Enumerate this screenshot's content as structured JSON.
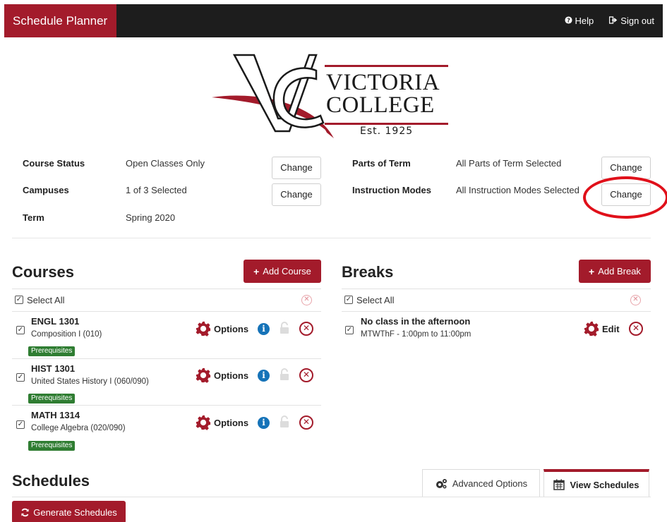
{
  "topbar": {
    "brand": "Schedule Planner",
    "help_label": "Help",
    "signout_label": "Sign out"
  },
  "logo": {
    "line1": "VICTORIA",
    "line2": "COLLEGE",
    "est": "Est. 1925"
  },
  "filters": {
    "course_status": {
      "label": "Course Status",
      "value": "Open Classes Only",
      "button": "Change"
    },
    "campuses": {
      "label": "Campuses",
      "value": "1 of 3 Selected",
      "button": "Change"
    },
    "term": {
      "label": "Term",
      "value": "Spring 2020"
    },
    "parts_of_term": {
      "label": "Parts of Term",
      "value": "All Parts of Term Selected",
      "button": "Change"
    },
    "instruction_modes": {
      "label": "Instruction Modes",
      "value": "All Instruction Modes Selected",
      "button": "Change"
    }
  },
  "courses": {
    "title": "Courses",
    "add_label": "Add Course",
    "select_all": "Select All",
    "items": [
      {
        "code": "ENGL 1301",
        "name": "Composition I (010)",
        "badge": "Prerequisites",
        "options": "Options"
      },
      {
        "code": "HIST 1301",
        "name": "United States History I (060/090)",
        "badge": "Prerequisites",
        "options": "Options"
      },
      {
        "code": "MATH 1314",
        "name": "College Algebra (020/090)",
        "badge": "Prerequisites",
        "options": "Options"
      }
    ]
  },
  "breaks": {
    "title": "Breaks",
    "add_label": "Add Break",
    "select_all": "Select All",
    "items": [
      {
        "title": "No class in the afternoon",
        "detail": "MTWThF - 1:00pm to 11:00pm",
        "edit": "Edit"
      }
    ]
  },
  "schedules": {
    "title": "Schedules",
    "tab_advanced": "Advanced Options",
    "tab_view": "View Schedules",
    "generate_label": "Generate Schedules"
  },
  "colors": {
    "brand_red": "#a31b2b",
    "topbar_dark": "#1d1d1d",
    "badge_green": "#2f7d32",
    "info_blue": "#1673b8",
    "highlight_red": "#e0101a"
  }
}
